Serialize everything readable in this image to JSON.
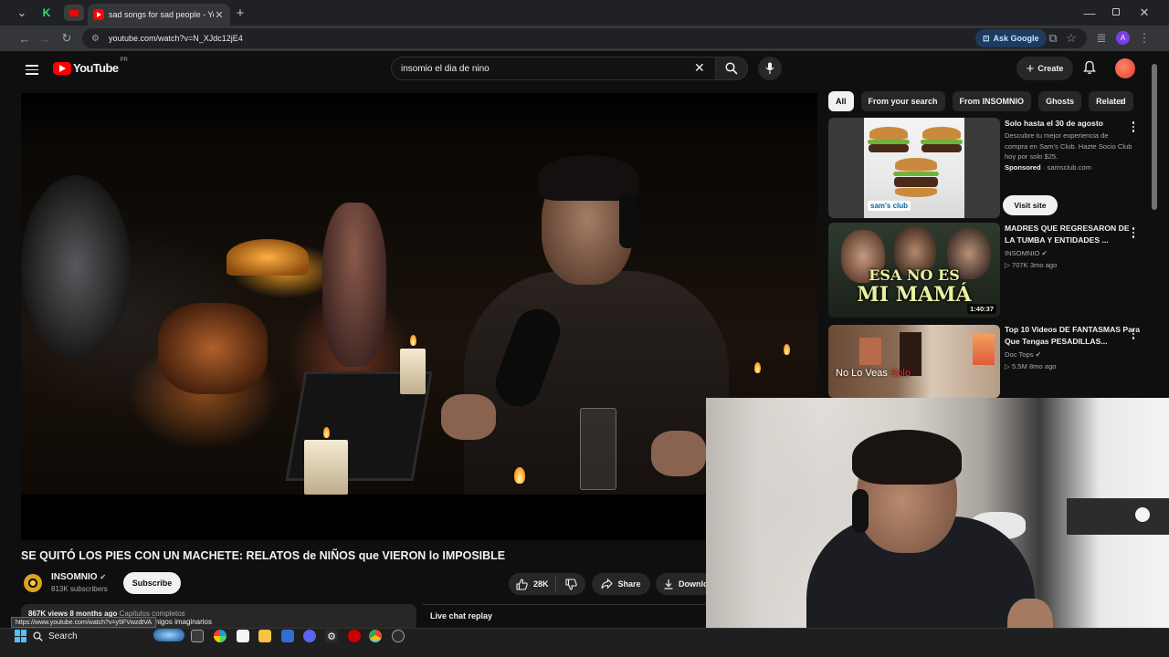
{
  "browser": {
    "tab_title": "sad songs for sad people - You",
    "url": "youtube.com/watch?v=N_XJdc12jE4",
    "ask_google": "Ask Google",
    "profile_initial": "A",
    "new_tab": "+"
  },
  "header": {
    "logo_text": "YouTube",
    "region": "PR",
    "search_query": "insomio el dia de nino",
    "create_label": "Create"
  },
  "video": {
    "title": "SE QUITÓ LOS PIES CON UN MACHETE: RELATOS de NIÑOS que VIERON lo IMPOSIBLE",
    "channel_name": "INSOMNIO",
    "subscribers": "813K subscribers",
    "subscribe_label": "Subscribe",
    "likes": "28K",
    "share_label": "Share",
    "download_label": "Download",
    "desc_views": "867K views  8 months ago",
    "desc_text": "Capitulos completos",
    "desc_line2": "Relatos paranormales de la infancia, amigos imaginarios",
    "live_chat_replay": "Live chat replay",
    "status_url": "https://www.youtube.com/watch?v=y5FVwzdtVA"
  },
  "sidebar": {
    "chips": [
      "All",
      "From your search",
      "From INSOMNIO",
      "Ghosts",
      "Related"
    ],
    "ad": {
      "title": "Solo hasta el 30 de agosto",
      "description": "Descubre tu mejor experiencia de compra en Sam's Club. Hazte Socio Club hoy por solo $25.",
      "sponsored": "Sponsored",
      "domain": "samsclub.com",
      "cta": "Visit site",
      "logo_text": "sam's club"
    },
    "recs": [
      {
        "title": "MADRES QUE REGRESARON DE LA TUMBA Y ENTIDADES ...",
        "channel": "INSOMNIO",
        "meta": "707K  3mo ago",
        "duration": "1:40:37",
        "thumb_line1": "ESA NO ES",
        "thumb_line2": "MI MAMÁ"
      },
      {
        "title": "Top 10 Videos DE FANTASMAS Para Que Tengas PESADILLAS...",
        "channel": "Doc Tops",
        "meta": "5.5M  8mo ago",
        "thumb_text": "No Lo Veas",
        "thumb_text_red": "Solo"
      }
    ]
  },
  "taskbar": {
    "search_label": "Search"
  },
  "colors": {
    "yt_red": "#ff0000",
    "background": "#0f0f0f",
    "chip_active": "#f1f1f1",
    "ask_google_bg": "#1f3a5f"
  },
  "icons": [
    "hamburger-icon",
    "youtube-logo-icon",
    "search-icon",
    "mic-icon",
    "bell-icon",
    "thumb-up-icon",
    "thumb-down-icon",
    "share-icon",
    "download-icon",
    "verified-icon",
    "kebab-icon",
    "chevron-right-icon"
  ]
}
